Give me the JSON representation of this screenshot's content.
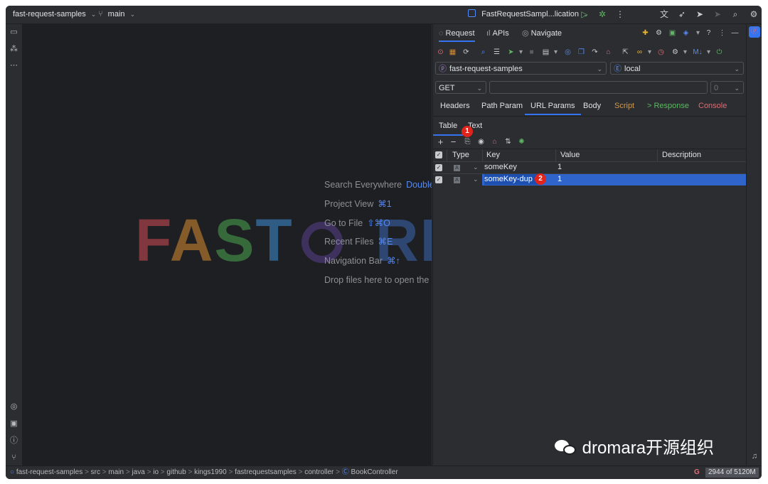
{
  "titlebar": {
    "project": "fast-request-samples",
    "branch": "main",
    "run_config": "FastRequestSampl...lication"
  },
  "panel": {
    "tabs": [
      "Request",
      "APIs",
      "Navigate"
    ],
    "project_select": "fast-request-samples",
    "env_select": "local",
    "method": "GET",
    "url_value": "",
    "count": "0",
    "sub_tabs": {
      "headers": "Headers",
      "path_param": "Path Param",
      "url_params": "URL Params",
      "body": "Body",
      "script": "Script",
      "response": "> Response",
      "console": "Console"
    },
    "view_tabs": {
      "table": "Table",
      "text": "Text"
    },
    "columns": {
      "type": "Type",
      "key": "Key",
      "value": "Value",
      "description": "Description"
    },
    "rows": [
      {
        "type": "A",
        "key": "someKey",
        "value": "1",
        "description": ""
      },
      {
        "type": "A",
        "key": "someKey-dup",
        "value": "1",
        "description": ""
      }
    ],
    "annotations": [
      "1",
      "2"
    ]
  },
  "editor": {
    "hints": [
      {
        "label": "Search Everywhere",
        "key": "Double"
      },
      {
        "label": "Project View",
        "key": "⌘1"
      },
      {
        "label": "Go to File",
        "key": "⇧⌘O"
      },
      {
        "label": "Recent Files",
        "key": "⌘E"
      },
      {
        "label": "Navigation Bar",
        "key": "⌘↑"
      },
      {
        "label": "Drop files here to open the",
        "key": ""
      }
    ],
    "watermark_left": "FAST",
    "watermark_right": "REQUEST"
  },
  "statusbar": {
    "breadcrumb": [
      "fast-request-samples",
      "src",
      "main",
      "java",
      "io",
      "github",
      "kings1990",
      "fastrequestsamples",
      "controller",
      "BookController"
    ],
    "memory": "2944 of 5120M"
  },
  "overlay": {
    "label": "dromara开源组织"
  },
  "colors": {
    "accent": "#3574f0",
    "selection": "#2f65ca",
    "script": "#d19a4d",
    "response": "#5fb865",
    "console": "#e06c75",
    "badge": "#e0241c"
  }
}
